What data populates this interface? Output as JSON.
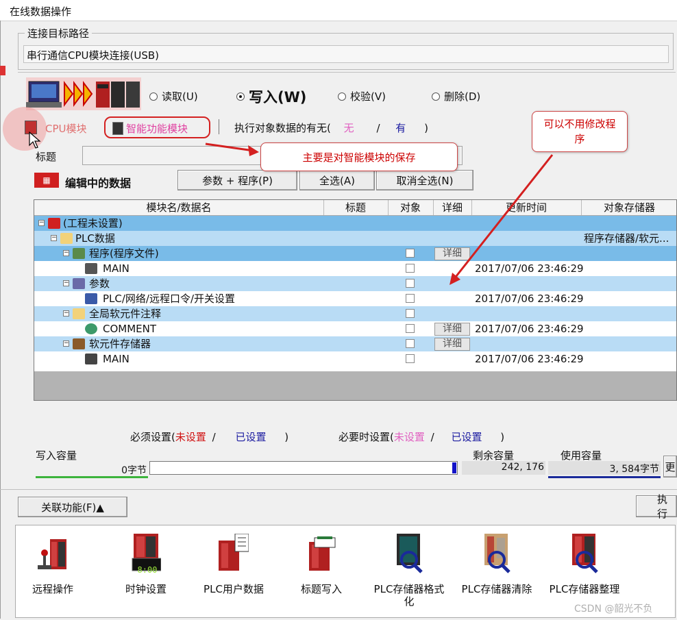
{
  "window": {
    "title": "在线数据操作"
  },
  "connection": {
    "group_label": "连接目标路径",
    "path": "串行通信CPU模块连接(USB)"
  },
  "modes": {
    "read": "读取(U)",
    "write": "写入(W)",
    "verify": "校验(V)",
    "delete": "删除(D)",
    "selected": "write"
  },
  "module_tabs": {
    "cpu": "CPU模块",
    "intelligent": "智能功能模块",
    "target_presence_prefix": "执行对象数据的有无(",
    "none": "无",
    "slash": "/",
    "has": "有",
    "close_paren": ")"
  },
  "title_field": {
    "label": "标题"
  },
  "editing": {
    "label": "编辑中的数据",
    "btn_param_program": "参数 + 程序(P)",
    "btn_select_all": "全选(A)",
    "btn_deselect_all": "取消全选(N)"
  },
  "table": {
    "headers": [
      "模块名/数据名",
      "标题",
      "对象",
      "详细",
      "更新时间",
      "对象存储器"
    ],
    "rows": [
      {
        "name": "(工程未设置)",
        "memory": "",
        "time": "",
        "detail": ""
      },
      {
        "name": "PLC数据",
        "memory": "程序存储器/软元...",
        "time": "",
        "detail": ""
      },
      {
        "name": "程序(程序文件)",
        "memory": "",
        "time": "",
        "detail": "详细"
      },
      {
        "name": "MAIN",
        "memory": "",
        "time": "2017/07/06 23:46:29",
        "detail": ""
      },
      {
        "name": "参数",
        "memory": "",
        "time": "",
        "detail": ""
      },
      {
        "name": "PLC/网络/远程口令/开关设置",
        "memory": "",
        "time": "2017/07/06 23:46:29",
        "detail": ""
      },
      {
        "name": "全局软元件注释",
        "memory": "",
        "time": "",
        "detail": ""
      },
      {
        "name": "COMMENT",
        "memory": "",
        "time": "2017/07/06 23:46:29",
        "detail": "详细"
      },
      {
        "name": "软元件存储器",
        "memory": "",
        "time": "",
        "detail": "详细"
      },
      {
        "name": "MAIN",
        "memory": "",
        "time": "2017/07/06 23:46:29",
        "detail": ""
      }
    ]
  },
  "legend": {
    "required_prefix": "必须设置(",
    "required_unset": "未设置",
    "slash": "/",
    "required_set": "已设置",
    "close_paren": ")",
    "optional_prefix": "必要时设置(",
    "optional_unset": "未设置",
    "optional_set": "已设置"
  },
  "capacity": {
    "write_label": "写入容量",
    "write_value": "0字节",
    "remaining_label": "剩余容量",
    "remaining_value": "242, 176",
    "used_label": "使用容量",
    "used_value": "3, 584字节",
    "more_btn": "更"
  },
  "footer": {
    "related_btn": "关联功能(F)▲",
    "execute_btn": "执行"
  },
  "tools": [
    {
      "label": "远程操作"
    },
    {
      "label": "时钟设置",
      "display": "8:00"
    },
    {
      "label": "PLC用户数据"
    },
    {
      "label": "标题写入"
    },
    {
      "label": "PLC存储器格式化"
    },
    {
      "label": "PLC存储器清除"
    },
    {
      "label": "PLC存储器整理"
    }
  ],
  "annotations": {
    "callout_main": "主要是对智能模块的保存",
    "callout_modify": "可以不用修改程序"
  },
  "watermark": "CSDN @韶光不负",
  "colors": {
    "selected_row": "#79bbe8",
    "light_row": "#b9dcf5",
    "annotation_red": "#d42020",
    "unset_red": "#d01010",
    "set_blue": "#1a1aa0",
    "optional_pink": "#e060c0"
  }
}
